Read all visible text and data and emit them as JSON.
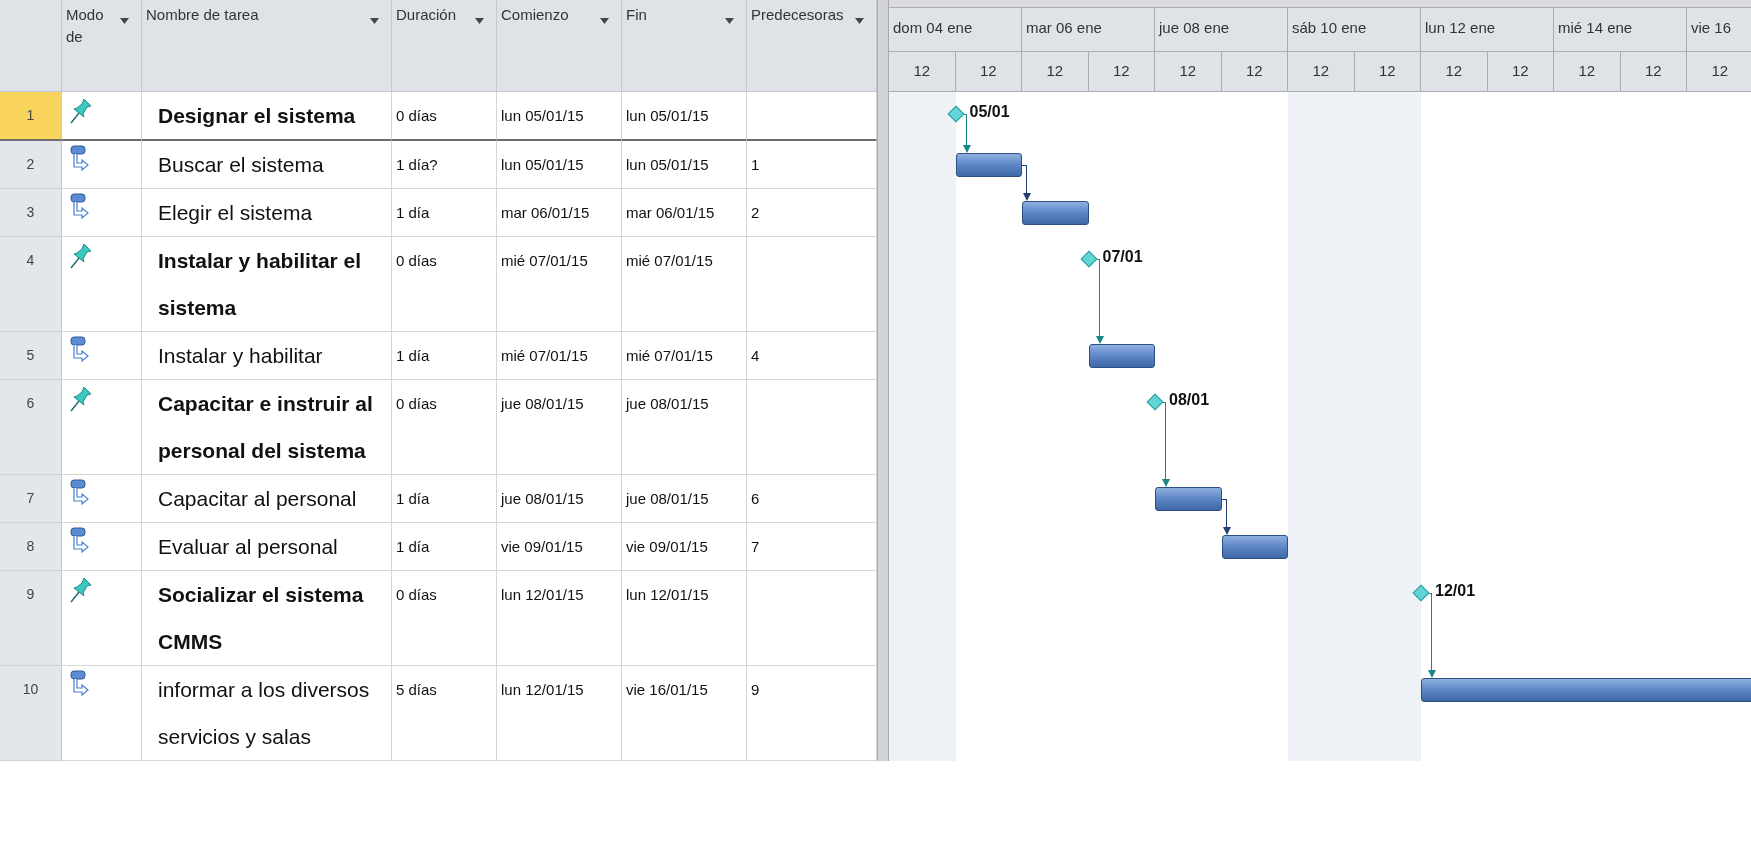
{
  "table": {
    "columns": [
      {
        "label": "Modo de"
      },
      {
        "label": "Nombre de tarea"
      },
      {
        "label": "Duración"
      },
      {
        "label": "Comienzo"
      },
      {
        "label": "Fin"
      },
      {
        "label": "Predecesoras"
      }
    ],
    "rows": [
      {
        "number": "1",
        "selected": true,
        "manual": true,
        "milestone": true,
        "name": "Designar el sistema",
        "duration": "0 días",
        "start": "lun 05/01/15",
        "finish": "lun 05/01/15",
        "milestone_label": "05/01"
      },
      {
        "number": "2",
        "selected": false,
        "manual": false,
        "milestone": false,
        "name": "Buscar el sistema",
        "duration": "1 día?",
        "start": "lun 05/01/15",
        "finish": "lun 05/01/15",
        "predecessors": "1"
      },
      {
        "number": "3",
        "selected": false,
        "manual": false,
        "milestone": false,
        "name": "Elegir el sistema",
        "duration": "1 día",
        "start": "mar 06/01/15",
        "finish": "mar 06/01/15",
        "predecessors": "2"
      },
      {
        "number": "4",
        "selected": false,
        "manual": true,
        "milestone": true,
        "name": "Instalar y habilitar el sistema",
        "duration": "0 días",
        "start": "mié 07/01/15",
        "finish": "mié 07/01/15",
        "milestone_label": "07/01"
      },
      {
        "number": "5",
        "selected": false,
        "manual": false,
        "milestone": false,
        "name": "Instalar y habilitar",
        "duration": "1 día",
        "start": "mié 07/01/15",
        "finish": "mié 07/01/15",
        "predecessors": "4"
      },
      {
        "number": "6",
        "selected": false,
        "manual": true,
        "milestone": true,
        "name": "Capacitar e instruir al personal del sistema",
        "duration": "0 días",
        "start": "jue 08/01/15",
        "finish": "jue 08/01/15",
        "milestone_label": "08/01"
      },
      {
        "number": "7",
        "selected": false,
        "manual": false,
        "milestone": false,
        "name": "Capacitar al personal",
        "duration": "1 día",
        "start": "jue 08/01/15",
        "finish": "jue 08/01/15",
        "predecessors": "6"
      },
      {
        "number": "8",
        "selected": false,
        "manual": false,
        "milestone": false,
        "name": "Evaluar al personal",
        "duration": "1 día",
        "start": "vie 09/01/15",
        "finish": "vie 09/01/15",
        "predecessors": "7"
      },
      {
        "number": "9",
        "selected": false,
        "manual": true,
        "milestone": true,
        "name": "Socializar el sistema CMMS",
        "duration": "0 días",
        "start": "lun 12/01/15",
        "finish": "lun 12/01/15",
        "milestone_label": "12/01"
      },
      {
        "number": "10",
        "selected": false,
        "manual": false,
        "milestone": false,
        "name": "informar a los diversos servicios y salas",
        "duration": "5 días",
        "start": "lun 12/01/15",
        "finish": "vie 16/01/15",
        "predecessors": "9"
      }
    ]
  },
  "timescale": {
    "major": [
      "dom 04 ene",
      "mar 06 ene",
      "jue 08 ene",
      "sáb 10 ene",
      "lun 12 ene",
      "mié 14 ene",
      "vie 16"
    ],
    "minor": [
      "12",
      "12",
      "12",
      "12",
      "12",
      "12",
      "12",
      "12",
      "12",
      "12",
      "12",
      "12",
      "12"
    ]
  }
}
